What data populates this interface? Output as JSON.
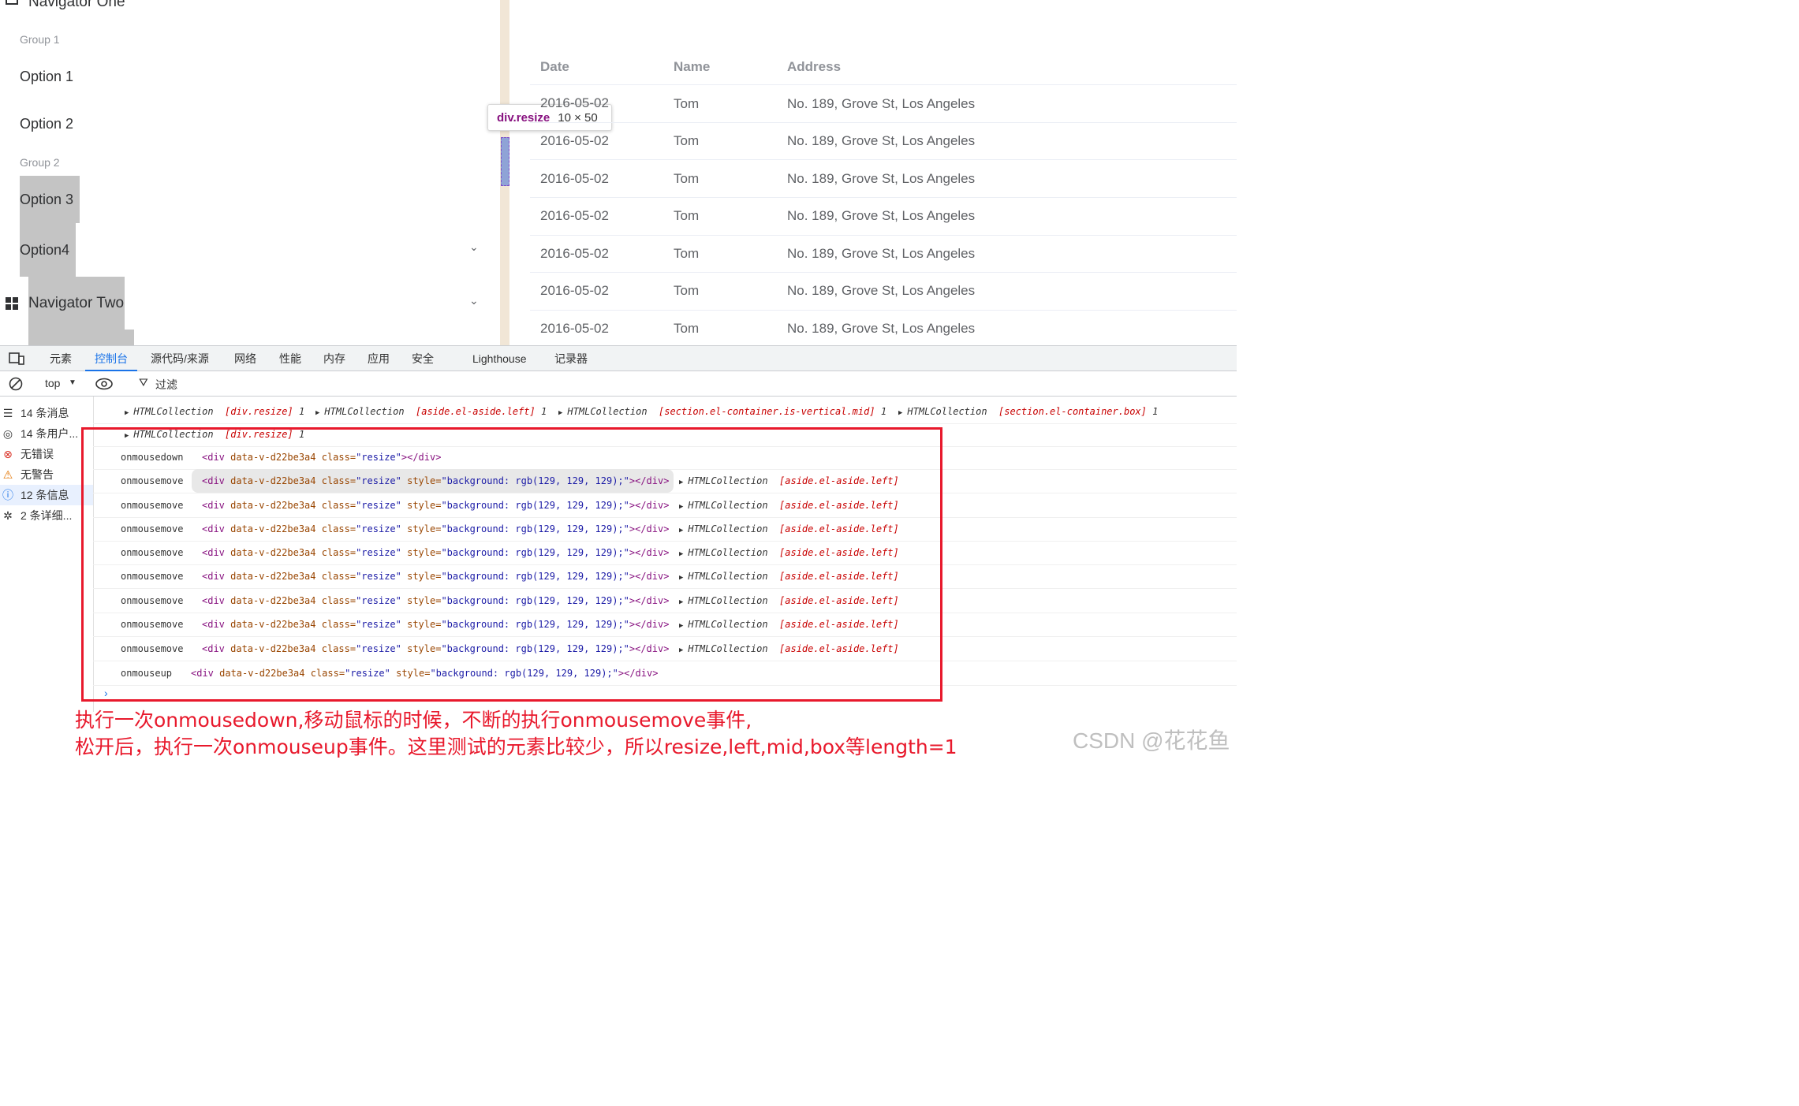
{
  "menu": {
    "nav_one": "Navigator One",
    "group1": "Group 1",
    "option1": "Option 1",
    "option2": "Option 2",
    "group2": "Group 2",
    "option3": "Option 3",
    "option4": "Option4",
    "nav_two": "Navigator Two"
  },
  "tooltip": {
    "selector": "div.resize",
    "size": "10 × 50"
  },
  "table": {
    "headers": [
      "Date",
      "Name",
      "Address"
    ],
    "rows": [
      {
        "date": "2016-05-02",
        "name": "Tom",
        "address": "No. 189, Grove St, Los Angeles"
      },
      {
        "date": "2016-05-02",
        "name": "Tom",
        "address": "No. 189, Grove St, Los Angeles"
      },
      {
        "date": "2016-05-02",
        "name": "Tom",
        "address": "No. 189, Grove St, Los Angeles"
      },
      {
        "date": "2016-05-02",
        "name": "Tom",
        "address": "No. 189, Grove St, Los Angeles"
      },
      {
        "date": "2016-05-02",
        "name": "Tom",
        "address": "No. 189, Grove St, Los Angeles"
      },
      {
        "date": "2016-05-02",
        "name": "Tom",
        "address": "No. 189, Grove St, Los Angeles"
      },
      {
        "date": "2016-05-02",
        "name": "Tom",
        "address": "No. 189, Grove St, Los Angeles"
      }
    ]
  },
  "devtools": {
    "tabs": [
      "元素",
      "控制台",
      "源代码/来源",
      "网络",
      "性能",
      "内存",
      "应用",
      "安全",
      "Lighthouse",
      "记录器"
    ],
    "active_tab": "控制台",
    "context": "top",
    "filter_placeholder": "过滤",
    "sidebar": [
      {
        "icon": "list-icon",
        "label": "14 条消息"
      },
      {
        "icon": "user-icon",
        "label": "14 条用户..."
      },
      {
        "icon": "error-icon",
        "label": "无错误"
      },
      {
        "icon": "warning-icon",
        "label": "无警告"
      },
      {
        "icon": "info-icon",
        "label": "12 条信息"
      },
      {
        "icon": "bug-icon",
        "label": "2 条详细..."
      }
    ],
    "log_first": {
      "items": [
        {
          "coll": "HTMLCollection",
          "inner": "[div.resize]",
          "len": "1"
        },
        {
          "coll": "HTMLCollection",
          "inner": "[aside.el-aside.left]",
          "len": "1"
        },
        {
          "coll": "HTMLCollection",
          "inner": "[section.el-container.is-vertical.mid]",
          "len": "1"
        },
        {
          "coll": "HTMLCollection",
          "inner": "[section.el-container.box]",
          "len": "1"
        }
      ]
    },
    "log_second": {
      "coll": "HTMLCollection",
      "inner": "[div.resize]",
      "len": "1"
    },
    "mousedown": {
      "event": "onmousedown",
      "tag_open": "<div ",
      "attr1": "data-v-d22be3a4",
      "attr2": " class=",
      "cls": "\"resize\"",
      "tag_close": "></div>"
    },
    "move_event": "onmousemove",
    "move_style_attr": " style=",
    "move_style_val": "\"background: rgb(129, 129, 129);\"",
    "move_coll": "HTMLCollection",
    "move_inner": "[aside.el-aside.left]",
    "mouseup": {
      "event": "onmouseup"
    }
  },
  "caption": {
    "line1": "执行一次onmousedown,移动鼠标的时候，不断的执行onmousemove事件,",
    "line2": "松开后，执行一次onmouseup事件。这里测试的元素比较少，所以resize,left,mid,box等length=1"
  },
  "watermark": "CSDN @花花鱼"
}
